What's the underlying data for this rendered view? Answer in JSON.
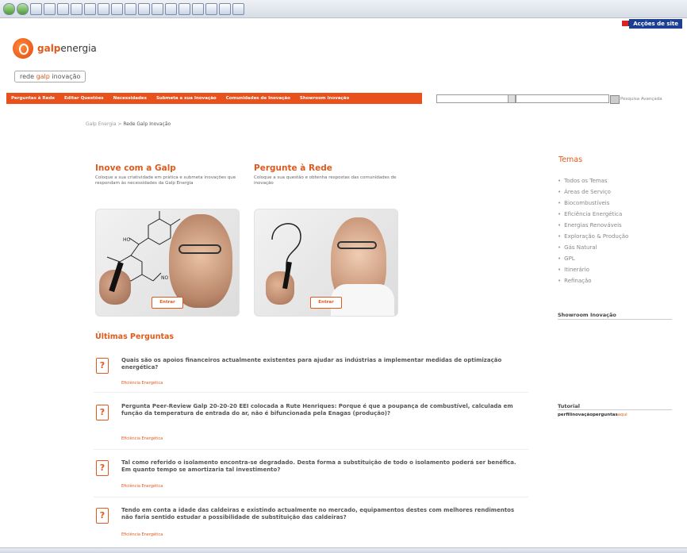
{
  "browser": {
    "toolbar_right": ""
  },
  "subbar": {
    "left": "",
    "right": "",
    "actions": "Acções de site"
  },
  "logo": {
    "brand": "galp",
    "suffix": "energia"
  },
  "badge": {
    "pre": "rede ",
    "brand": "galp",
    "post": " inovação"
  },
  "nav": [
    "Perguntas à Rede",
    "Editar Questões",
    "Necessidades",
    "Submeta a sua Inovação",
    "Comunidades de Inovação",
    "Showroom Inovação"
  ],
  "search": {
    "scope": "",
    "label": "Pesquisa Avançada"
  },
  "breadcrumb": {
    "root": "Galp Energia",
    "separator": " > ",
    "current": "Rede Galp Inovação"
  },
  "inove": {
    "title": "Inove com a Galp",
    "desc": "Coloque a sua criatividade em prática e submeta inovações que respondam às necessidades da Galp Energia",
    "button": "Entrar"
  },
  "pergunte": {
    "title": "Pergunte à Rede",
    "desc": "Coloque a sua questão e obtenha respostas das comunidades de inovação",
    "button": "Entrar"
  },
  "questions_title": "Últimas Perguntas",
  "questions": [
    {
      "title": "Quais são os apoios financeiros actualmente existentes para ajudar as indústrias a implementar medidas de optimização energética?",
      "meta_pre": "",
      "author": "",
      "meta_mid": "",
      "category": "Eficiência Energética"
    },
    {
      "title": "Pergunta Peer-Review Galp 20-20-20 EEI colocada a Rute Henriques: Porque é que a poupança de combustível, calculada em função da temperatura de entrada do ar, não é bifuncionada pela Enagas (produção)?",
      "meta_pre": "",
      "author": "",
      "meta_mid": "",
      "category": "Eficiência Energética"
    },
    {
      "title": "Tal como referido o isolamento encontra-se degradado. Desta forma a substituição de todo o isolamento poderá ser benéfica. Em quanto tempo se amortizaria tal investimento?",
      "meta_pre": "",
      "author": "",
      "meta_mid": "",
      "category": "Eficiência Energética"
    },
    {
      "title": "Tendo em conta a idade das caldeiras e existindo actualmente no mercado, equipamentos destes com melhores rendimentos não faria sentido estudar a possibilidade de substituição das caldeiras?",
      "meta_pre": "",
      "author": "",
      "meta_mid": "",
      "category": "Eficiência Energética"
    }
  ],
  "temas": {
    "title": "Temas",
    "items": [
      "Todos os Temas",
      "Áreas de Serviço",
      "Biocombustíveis",
      "Eficiência Energética",
      "Energias Renováveis",
      "Exploração & Produção",
      "Gás Natural",
      "GPL",
      "Itinerário",
      "Refinação"
    ]
  },
  "showroom": {
    "title": "Showroom Inovação",
    "links": [
      "",
      "",
      "",
      ""
    ]
  },
  "tutorial": {
    "title": "Tutorial",
    "t1": "",
    "perfil": "perfil",
    "t2": "",
    "inovacao": "inovação",
    "t3": "",
    "perguntas": "perguntas",
    "t4": "",
    "aqui": "aqui",
    "t5": ""
  }
}
